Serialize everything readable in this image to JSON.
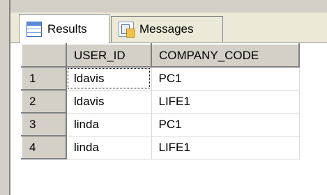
{
  "tabs": [
    {
      "label": "Results",
      "icon": "results-grid-icon",
      "active": true
    },
    {
      "label": "Messages",
      "icon": "messages-icon",
      "active": false
    }
  ],
  "grid": {
    "columns": [
      "USER_ID",
      "COMPANY_CODE"
    ],
    "rows": [
      {
        "num": "1",
        "user_id": "ldavis",
        "company_code": "PC1"
      },
      {
        "num": "2",
        "user_id": "ldavis",
        "company_code": "LIFE1"
      },
      {
        "num": "3",
        "user_id": "linda",
        "company_code": "PC1"
      },
      {
        "num": "4",
        "user_id": "linda",
        "company_code": "LIFE1"
      }
    ],
    "selected_cell": {
      "row": 1,
      "column": "USER_ID"
    }
  }
}
